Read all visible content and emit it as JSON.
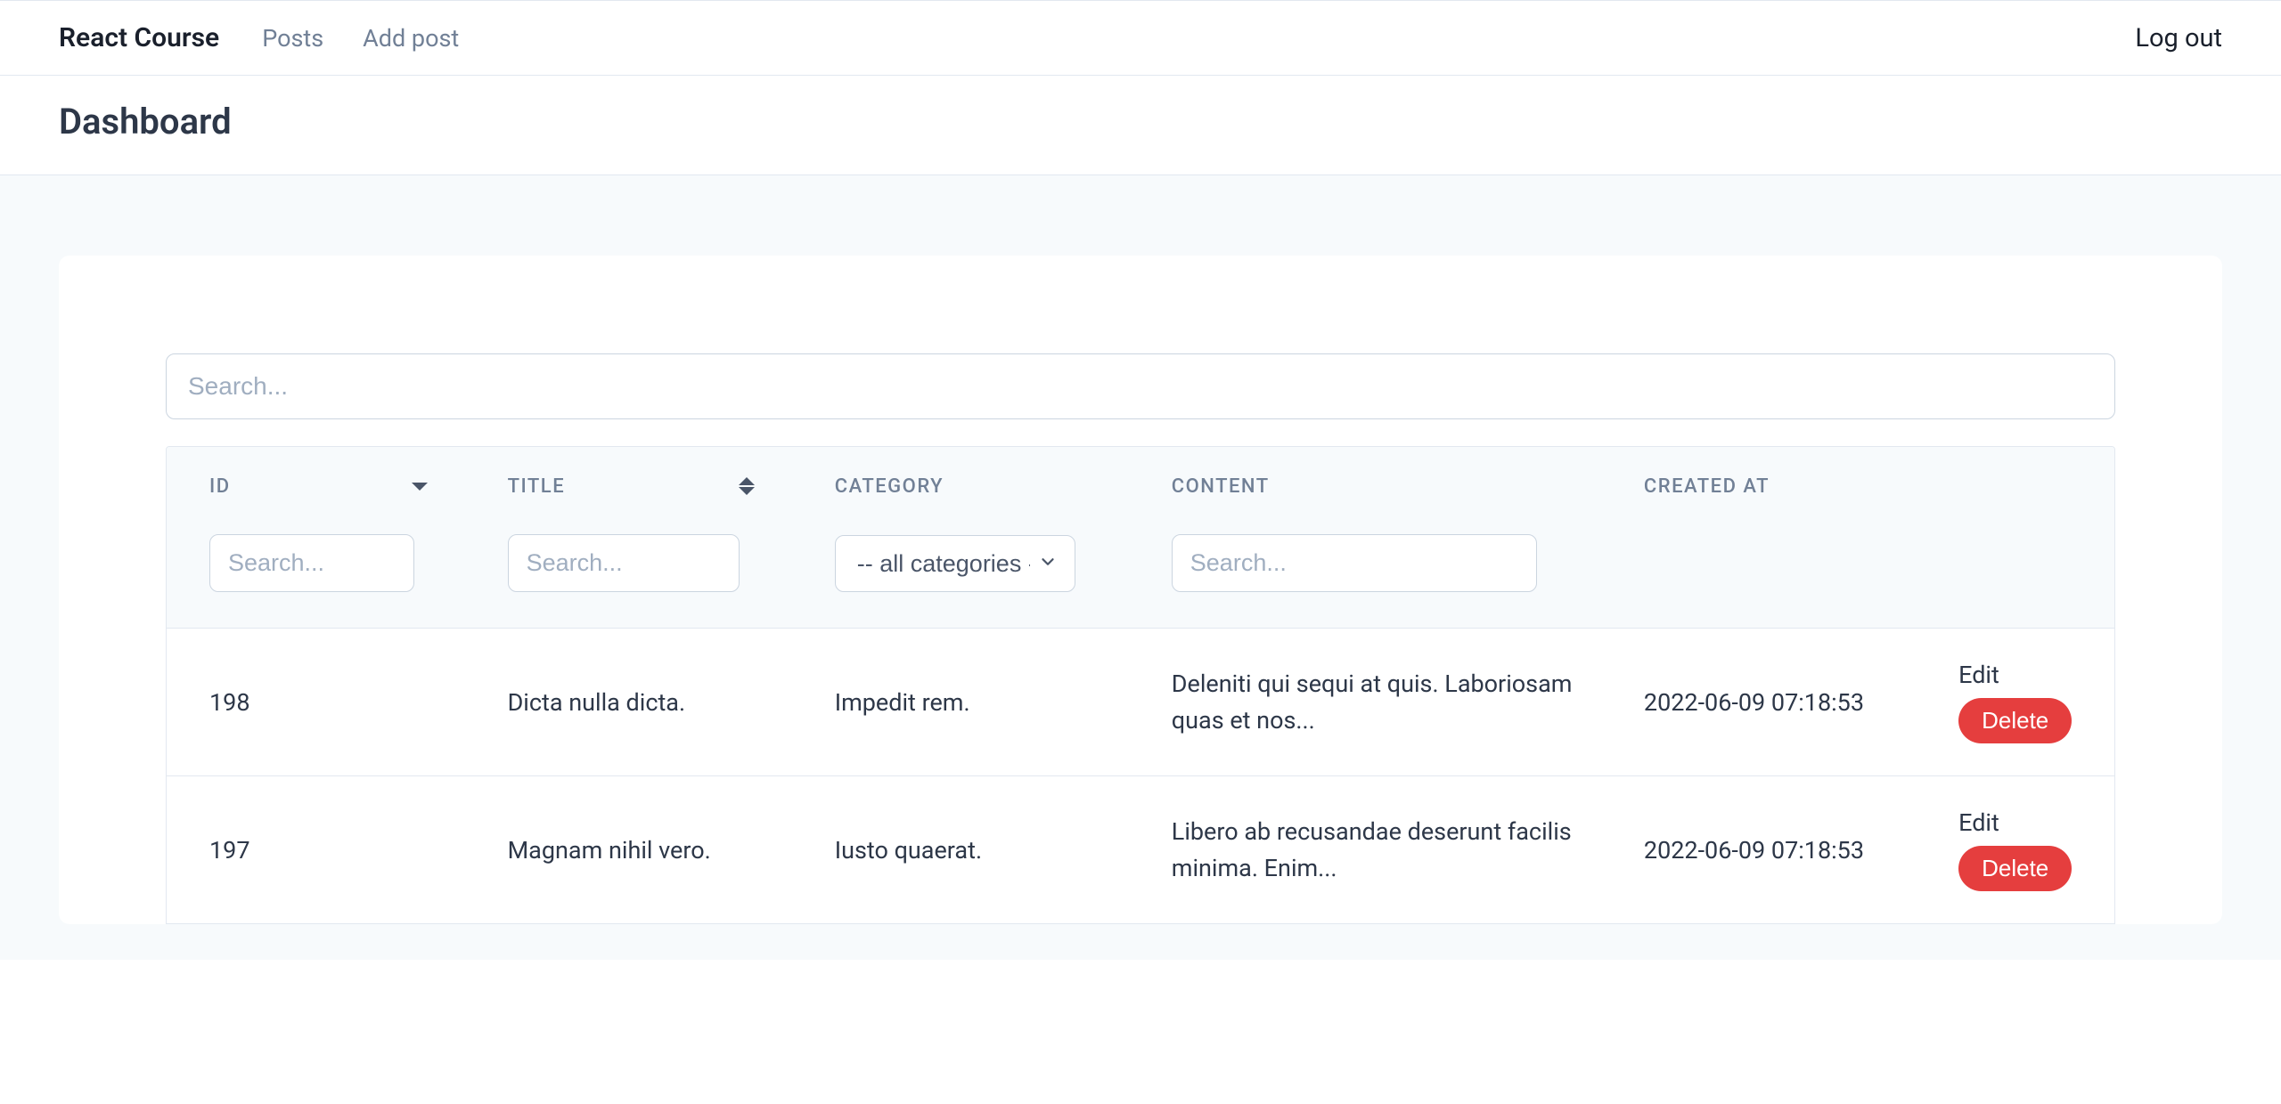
{
  "nav": {
    "brand": "React Course",
    "links": [
      "Posts",
      "Add post"
    ],
    "logout": "Log out"
  },
  "page": {
    "title": "Dashboard"
  },
  "search": {
    "placeholder": "Search..."
  },
  "table": {
    "columns": {
      "id": "ID",
      "title": "TITLE",
      "category": "CATEGORY",
      "content": "CONTENT",
      "created_at": "CREATED AT"
    },
    "filters": {
      "search_placeholder": "Search...",
      "category_selected": "-- all categories --"
    },
    "actions": {
      "edit": "Edit",
      "delete": "Delete"
    },
    "rows": [
      {
        "id": "198",
        "title": "Dicta nulla dicta.",
        "category": "Impedit rem.",
        "content": "Deleniti qui sequi at quis. Laboriosam quas et nos...",
        "created_at": "2022-06-09 07:18:53"
      },
      {
        "id": "197",
        "title": "Magnam nihil vero.",
        "category": "Iusto quaerat.",
        "content": "Libero ab recusandae deserunt facilis minima. Enim...",
        "created_at": "2022-06-09 07:18:53"
      }
    ]
  }
}
